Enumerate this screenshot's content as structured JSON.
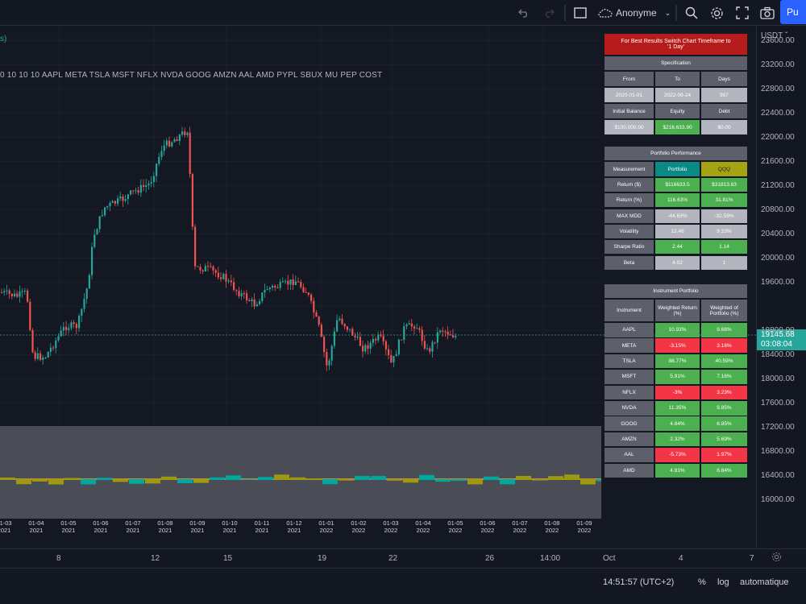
{
  "toolbar": {
    "undo_icon": "undo-icon",
    "redo_icon": "redo-icon",
    "layout_icon": "layout-square-icon",
    "layout_name": "Anonyme",
    "publish_label": "Pu"
  },
  "chart": {
    "indicator_tag": "s)",
    "symbols_line": "0 10 10 10 AAPL META TSLA MSFT NFLX NVDA GOOG AMZN AAL AMD PYPL SBUX MU PEP COST",
    "currency": "USDT",
    "price_labels": [
      "23600.00",
      "23200.00",
      "22800.00",
      "22400.00",
      "22000.00",
      "21600.00",
      "21200.00",
      "20800.00",
      "20400.00",
      "20000.00",
      "19600.00",
      "18800.00",
      "18400.00",
      "18000.00",
      "17600.00",
      "17200.00",
      "16800.00",
      "16400.00",
      "16000.00"
    ],
    "last_price": "19145.68",
    "countdown": "03:08:04",
    "osc_dates": [
      {
        "d": "01-03",
        "y": "2021"
      },
      {
        "d": "01-04",
        "y": "2021"
      },
      {
        "d": "01-05",
        "y": "2021"
      },
      {
        "d": "01-06",
        "y": "2021"
      },
      {
        "d": "01-07",
        "y": "2021"
      },
      {
        "d": "01-08",
        "y": "2021"
      },
      {
        "d": "01-09",
        "y": "2021"
      },
      {
        "d": "01-10",
        "y": "2021"
      },
      {
        "d": "01-11",
        "y": "2021"
      },
      {
        "d": "01-12",
        "y": "2021"
      },
      {
        "d": "01-01",
        "y": "2022"
      },
      {
        "d": "01-02",
        "y": "2022"
      },
      {
        "d": "01-03",
        "y": "2022"
      },
      {
        "d": "01-04",
        "y": "2022"
      },
      {
        "d": "01-05",
        "y": "2022"
      },
      {
        "d": "01-06",
        "y": "2022"
      },
      {
        "d": "01-07",
        "y": "2022"
      },
      {
        "d": "01-08",
        "y": "2022"
      },
      {
        "d": "01-09",
        "y": "2022"
      }
    ],
    "time_labels": [
      "8",
      "12",
      "15",
      "19",
      "22",
      "26",
      "14:00",
      "Oct",
      "4",
      "7"
    ]
  },
  "status": {
    "clock": "14:51:57 (UTC+2)",
    "percent": "%",
    "log": "log",
    "auto": "automatique"
  },
  "spec": {
    "banner": "For Best Results Switch Chart Timeframe to '1 Day'",
    "title": "Specification",
    "from_label": "From",
    "to_label": "To",
    "days_label": "Days",
    "from": "2020-01-01",
    "to": "2022-09-24",
    "days": "997",
    "initial_label": "Initial Balance",
    "equity_label": "Equity",
    "debt_label": "Debt",
    "initial": "$100,000.00",
    "equity": "$216,633.90",
    "debt": "$0.00"
  },
  "perf": {
    "title": "Portfolio Performance",
    "headers": [
      "Measurement",
      "Portfolio",
      "QQQ"
    ],
    "rows": [
      {
        "label": "Return ($)",
        "portfolio": "$116633.5",
        "qqq": "$31813.83",
        "p_color": "green",
        "q_color": "green"
      },
      {
        "label": "Return (%)",
        "portfolio": "116.63%",
        "qqq": "31.81%",
        "p_color": "green",
        "q_color": "green"
      },
      {
        "label": "MAX MDD",
        "portfolio": "-44.63%",
        "qqq": "-32.59%",
        "p_color": "light",
        "q_color": "light"
      },
      {
        "label": "Volatility",
        "portfolio": "12.46",
        "qqq": "9.33%",
        "p_color": "light",
        "q_color": "light"
      },
      {
        "label": "Sharpe Ratio",
        "portfolio": "2.44",
        "qqq": "1.14",
        "p_color": "green",
        "q_color": "green"
      },
      {
        "label": "Beta",
        "portfolio": "4.02",
        "qqq": "1",
        "p_color": "light",
        "q_color": "light"
      }
    ]
  },
  "instruments": {
    "title": "Instrument Portfolio",
    "headers": [
      "Instrument",
      "Weighted Return (%)",
      "Weighted of Portfolio (%)"
    ],
    "rows": [
      {
        "name": "AAPL",
        "ret": "10.93%",
        "weight": "9.66%",
        "r_color": "green",
        "w_color": "green"
      },
      {
        "name": "META",
        "ret": "-3.15%",
        "weight": "3.16%",
        "r_color": "red",
        "w_color": "red"
      },
      {
        "name": "TSLA",
        "ret": "88.77%",
        "weight": "40.59%",
        "r_color": "green",
        "w_color": "green"
      },
      {
        "name": "MSFT",
        "ret": "5.91%",
        "weight": "7.16%",
        "r_color": "green",
        "w_color": "green"
      },
      {
        "name": "NFLX",
        "ret": "-3%",
        "weight": "3.23%",
        "r_color": "red",
        "w_color": "red"
      },
      {
        "name": "NVDA",
        "ret": "11.35%",
        "weight": "9.85%",
        "r_color": "green",
        "w_color": "green"
      },
      {
        "name": "GOOG",
        "ret": "4.84%",
        "weight": "6.85%",
        "r_color": "green",
        "w_color": "green"
      },
      {
        "name": "AMZN",
        "ret": "2.32%",
        "weight": "5.69%",
        "r_color": "green",
        "w_color": "green"
      },
      {
        "name": "AAL",
        "ret": "-5.73%",
        "weight": "1.97%",
        "r_color": "red",
        "w_color": "red"
      },
      {
        "name": "AMD",
        "ret": "4.81%",
        "weight": "6.84%",
        "r_color": "green",
        "w_color": "green"
      }
    ]
  },
  "colors": {
    "up": "#26a69a",
    "down": "#ef5350",
    "background": "#131722",
    "accent": "#2962ff"
  }
}
